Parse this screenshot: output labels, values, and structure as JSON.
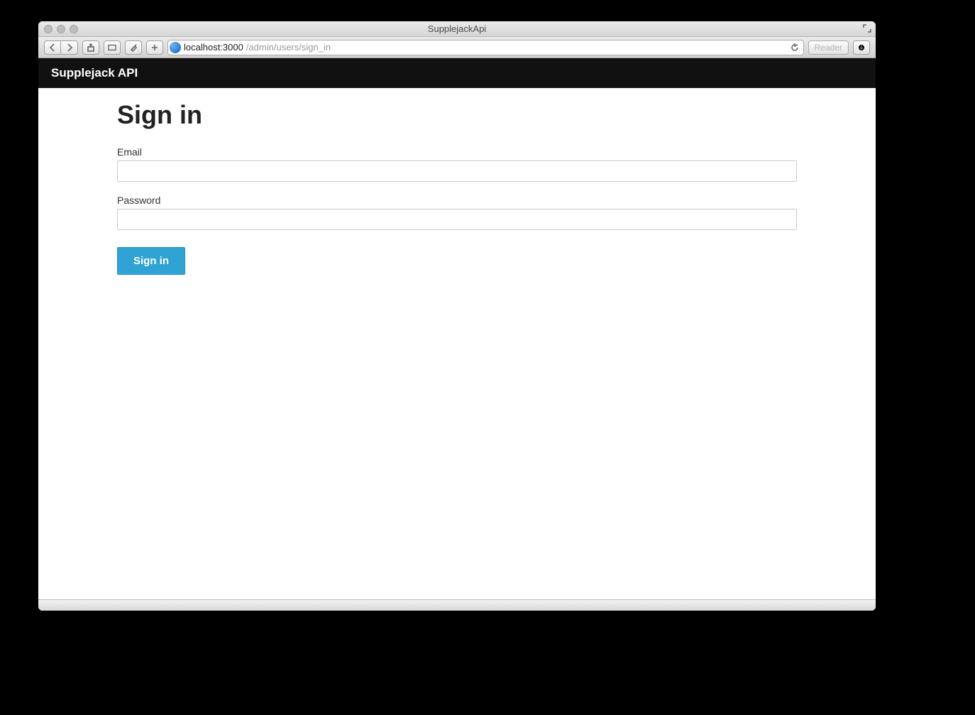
{
  "window": {
    "title": "SupplejackApi"
  },
  "addressbar": {
    "host": "localhost:3000",
    "path": "/admin/users/sign_in",
    "reader_label": "Reader"
  },
  "navbar": {
    "brand": "Supplejack API"
  },
  "page": {
    "heading": "Sign in"
  },
  "form": {
    "email": {
      "label": "Email",
      "value": ""
    },
    "password": {
      "label": "Password",
      "value": ""
    },
    "submit_label": "Sign in"
  }
}
